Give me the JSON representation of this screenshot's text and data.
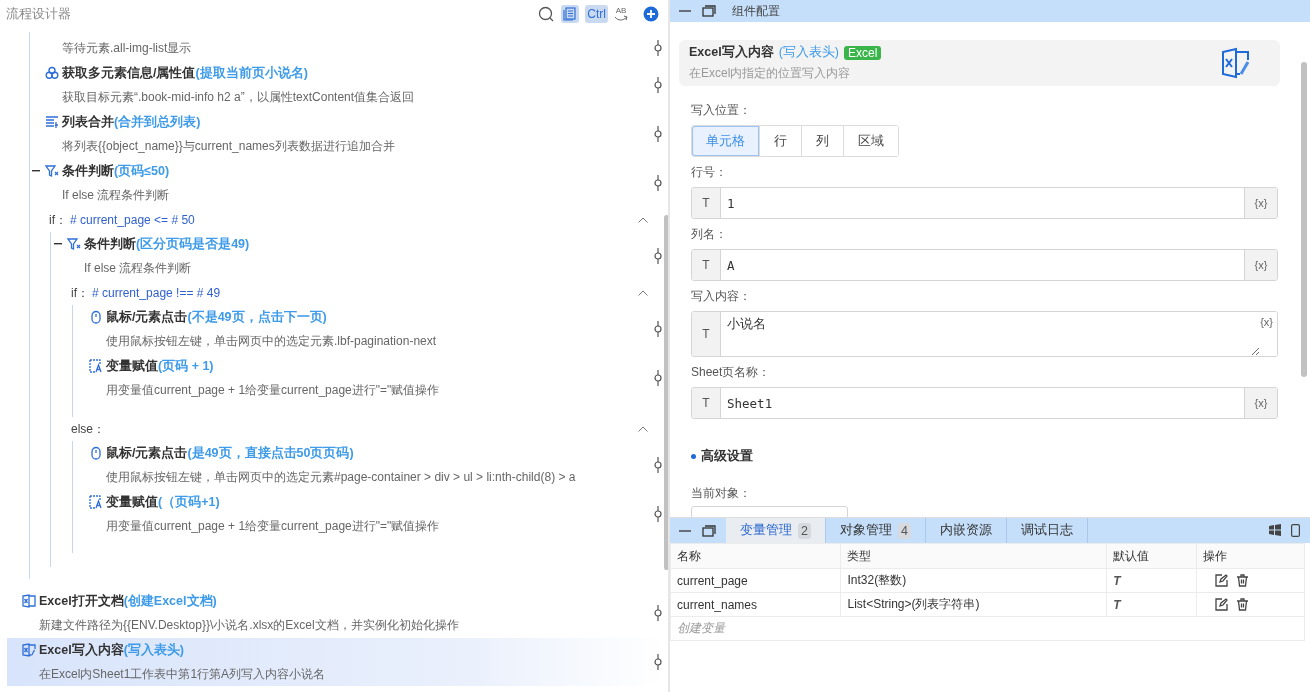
{
  "designer": {
    "title": "流程设计器",
    "toolbar": [
      {
        "kind": "search"
      },
      {
        "kind": "copy",
        "on": true
      },
      {
        "kind": "key",
        "label": "Ctrl",
        "on": true
      },
      {
        "kind": "spell",
        "label": "AB"
      },
      {
        "kind": "add"
      }
    ],
    "flow": [
      {
        "kind": "block",
        "children": [
          {
            "kind": "wait",
            "desc": "等待元素.all-img-list显示",
            "selected": false
          },
          {
            "kind": "multi",
            "title": "获取多元素信息/属性值",
            "note": "(提取当前页小说名)",
            "desc": "获取目标元素“.book-mid-info h2 a”，以属性textContent值集合返回",
            "selected": false
          },
          {
            "kind": "merge",
            "title": "列表合并",
            "note": "(合并到总列表)",
            "desc": "将列表{{object_name}}与current_names列表数据进行追加合并",
            "selected": false
          },
          {
            "kind": "condition",
            "title": "条件判断",
            "note": "(页码≤50)",
            "desc": "If else 流程条件判断",
            "expanded": true,
            "branches": [
              {
                "label": "if：",
                "expr": "# current_page <= # 50",
                "expanded": true,
                "children": [
                  {
                    "kind": "condition",
                    "title": "条件判断",
                    "note": "(区分页码是否是49)",
                    "desc": "If else 流程条件判断",
                    "expanded": true,
                    "branches": [
                      {
                        "label": "if：",
                        "expr": "# current_page !== # 49",
                        "expanded": true,
                        "children": [
                          {
                            "kind": "mouse",
                            "title": "鼠标/元素点击",
                            "note": "(不是49页，点击下一页)",
                            "desc": "使用鼠标按钮左键，单击网页中的选定元素.lbf-pagination-next",
                            "selected": false
                          },
                          {
                            "kind": "assign",
                            "title": "变量赋值",
                            "note": "(页码 + 1)",
                            "desc": "用变量值current_page + 1给变量current_page进行\"=\"赋值操作",
                            "selected": false
                          }
                        ]
                      },
                      {
                        "label": "else：",
                        "expanded": true,
                        "children": [
                          {
                            "kind": "mouse",
                            "title": "鼠标/元素点击",
                            "note": "(是49页，直接点击50页页码)",
                            "desc": "使用鼠标按钮左键，单击网页中的选定元素#page-container > div > ul > li:nth-child(8) > a",
                            "selected": false
                          },
                          {
                            "kind": "assign",
                            "title": "变量赋值",
                            "note": "(（页码+1)",
                            "desc": "用变量值current_page + 1给变量current_page进行\"=\"赋值操作",
                            "selected": false
                          }
                        ]
                      }
                    ]
                  }
                ]
              }
            ]
          }
        ]
      },
      {
        "kind": "excel",
        "title": "Excel打开文档",
        "note": "(创建Excel文档)",
        "desc": "新建文件路径为{{ENV.Desktop}}\\小说名.xlsx的Excel文档，并实例化初始化操作",
        "selected": false
      },
      {
        "kind": "excel-write",
        "title": "Excel写入内容",
        "note": "(写入表头)",
        "desc": "在Excel内Sheet1工作表中第1行第A列写入内容小说名",
        "selected": true
      }
    ]
  },
  "config": {
    "title": "组件配置",
    "component": {
      "title": "Excel写入内容",
      "note": "(写入表头)",
      "badge": "Excel",
      "desc": "在Excel内指定的位置写入内容"
    },
    "position": {
      "label": "写入位置：",
      "options": [
        {
          "label": "单元格",
          "selected": true
        },
        {
          "label": "行",
          "selected": false
        },
        {
          "label": "列",
          "selected": false
        },
        {
          "label": "区域",
          "selected": false
        }
      ]
    },
    "fields": [
      {
        "label": "行号：",
        "kind": "input",
        "type_tag": "T",
        "value": "1",
        "var_tag": "{x}"
      },
      {
        "label": "列名：",
        "kind": "input",
        "type_tag": "T",
        "value": "A",
        "var_tag": "{x}"
      },
      {
        "label": "写入内容：",
        "kind": "textarea",
        "type_tag": "T",
        "value": "小说名",
        "var_tag": "{x}"
      },
      {
        "label": "Sheet页名称：",
        "kind": "input",
        "type_tag": "T",
        "value": "Sheet1",
        "var_tag": "{x}"
      }
    ],
    "advanced": {
      "title": "高级设置",
      "field_label": "当前对象："
    }
  },
  "vars_panel": {
    "tabs": [
      {
        "label": "变量管理",
        "count": "2",
        "selected": true
      },
      {
        "label": "对象管理",
        "count": "4",
        "selected": false
      },
      {
        "label": "内嵌资源",
        "selected": false
      },
      {
        "label": "调试日志",
        "selected": false
      }
    ],
    "columns": [
      "名称",
      "类型",
      "默认值",
      "操作"
    ],
    "rows": [
      {
        "name": "current_page",
        "type": "Int32(整数)",
        "default_tag": "T"
      },
      {
        "name": "current_names",
        "type": "List<String>(列表字符串)",
        "default_tag": "T"
      }
    ],
    "create_label": "创建变量"
  }
}
